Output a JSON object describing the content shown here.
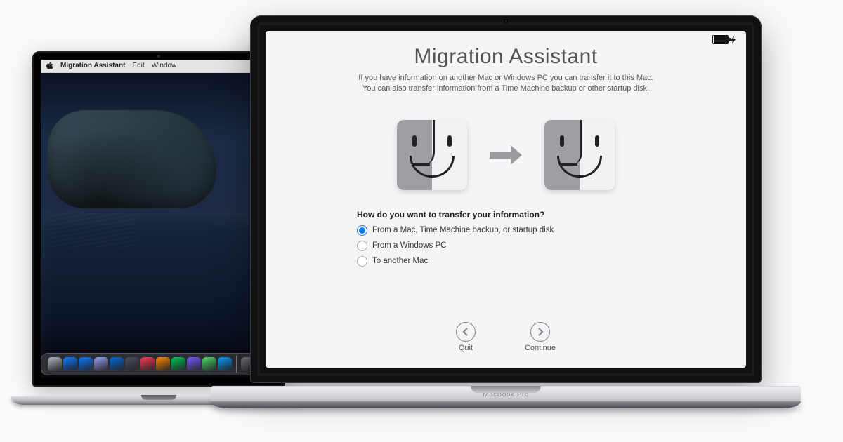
{
  "background_laptop": {
    "menubar": {
      "app_name": "Migration Assistant",
      "items": [
        "Edit",
        "Window"
      ]
    },
    "dock_colors": [
      "#b0b7c1",
      "#0a7aff",
      "#0a7aff",
      "#999ff5",
      "#036bd6",
      "#4a5160",
      "#ff3b57",
      "#ff8a00",
      "#00c853",
      "#7b5cff",
      "#4cd964",
      "#0aa0ff",
      "#7c7c80",
      "#555"
    ]
  },
  "foreground_laptop": {
    "model_label": "MacBook Pro",
    "window": {
      "battery_icon": "battery-charging-icon",
      "title": "Migration Assistant",
      "description_line1": "If you have information on another Mac or Windows PC you can transfer it to this Mac.",
      "description_line2": "You can also transfer information from a Time Machine backup or other startup disk.",
      "question": "How do you want to transfer your information?",
      "options": [
        {
          "id": "from-mac",
          "label": "From a Mac, Time Machine backup, or startup disk",
          "selected": true
        },
        {
          "id": "from-pc",
          "label": "From a Windows PC",
          "selected": false
        },
        {
          "id": "to-mac",
          "label": "To another Mac",
          "selected": false
        }
      ],
      "actions": {
        "quit": {
          "label": "Quit",
          "icon": "arrow-left-circle-icon"
        },
        "continue": {
          "label": "Continue",
          "icon": "arrow-right-circle-icon"
        }
      },
      "hero_icons": {
        "left": "finder-face-icon",
        "arrow": "arrow-right-icon",
        "right": "finder-face-icon"
      }
    }
  }
}
